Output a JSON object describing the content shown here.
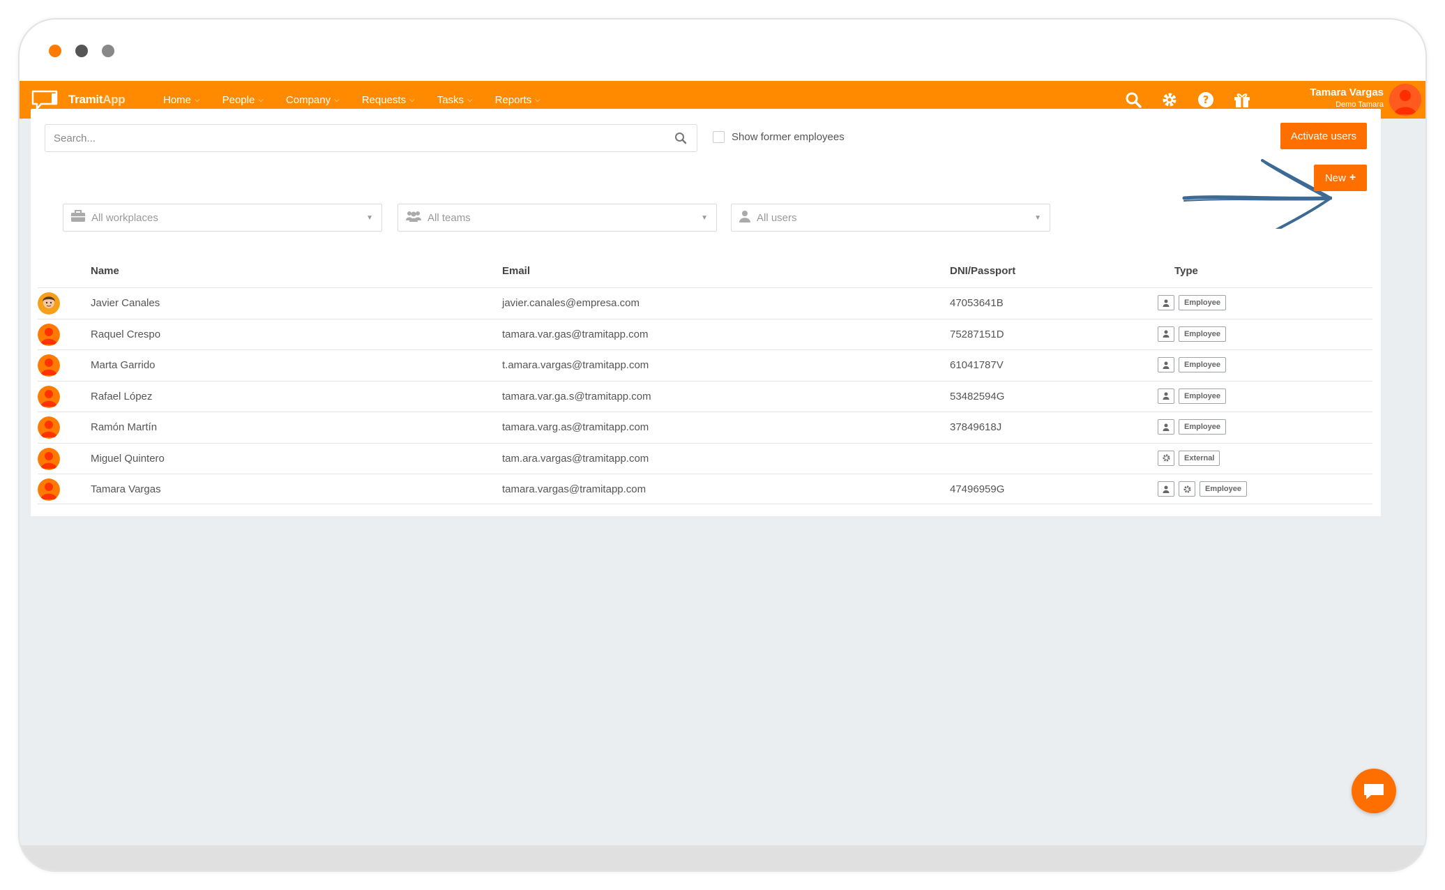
{
  "app": {
    "logo_word1": "Tramit",
    "logo_word2": "App",
    "brand_color": "#ff8a00",
    "accent_color": "#ff6f00"
  },
  "nav": {
    "items": [
      {
        "label": "Home"
      },
      {
        "label": "People"
      },
      {
        "label": "Company"
      },
      {
        "label": "Requests"
      },
      {
        "label": "Tasks"
      },
      {
        "label": "Reports"
      }
    ],
    "active": "People"
  },
  "top_icons": [
    "search-icon",
    "gear-icon",
    "help-icon",
    "gift-icon"
  ],
  "user": {
    "name": "Tamara Vargas",
    "org": "Demo Tamara"
  },
  "toolbar": {
    "search_placeholder": "Search...",
    "former_label": "Show former employees",
    "activate_label": "Activate users",
    "new_label": "New"
  },
  "filters": {
    "workplaces": "All workplaces",
    "teams": "All teams",
    "users": "All users"
  },
  "table": {
    "columns": [
      "Name",
      "Email",
      "DNI/Passport",
      "Type"
    ],
    "rows": [
      {
        "name": "Javier Canales",
        "email": "javier.canales@empresa.com",
        "dni": "47053641B",
        "types": [
          "user-icon"
        ],
        "label": "Employee",
        "avatar": "photo"
      },
      {
        "name": "Raquel Crespo",
        "email": "tamara.var.gas@tramitapp.com",
        "dni": "75287151D",
        "types": [
          "user-icon"
        ],
        "label": "Employee",
        "avatar": "default"
      },
      {
        "name": "Marta Garrido",
        "email": "t.amara.vargas@tramitapp.com",
        "dni": "61041787V",
        "types": [
          "user-icon"
        ],
        "label": "Employee",
        "avatar": "default"
      },
      {
        "name": "Rafael López",
        "email": "tamara.var.ga.s@tramitapp.com",
        "dni": "53482594G",
        "types": [
          "user-icon"
        ],
        "label": "Employee",
        "avatar": "default"
      },
      {
        "name": "Ramón Martín",
        "email": "tamara.varg.as@tramitapp.com",
        "dni": "37849618J",
        "types": [
          "user-icon"
        ],
        "label": "Employee",
        "avatar": "default"
      },
      {
        "name": "Miguel Quintero",
        "email": "tam.ara.vargas@tramitapp.com",
        "dni": "",
        "types": [
          "gear-icon"
        ],
        "label": "External",
        "avatar": "default"
      },
      {
        "name": "Tamara Vargas",
        "email": "tamara.vargas@tramitapp.com",
        "dni": "47496959G",
        "types": [
          "user-icon",
          "gear-icon"
        ],
        "label": "Employee",
        "avatar": "default"
      }
    ]
  }
}
